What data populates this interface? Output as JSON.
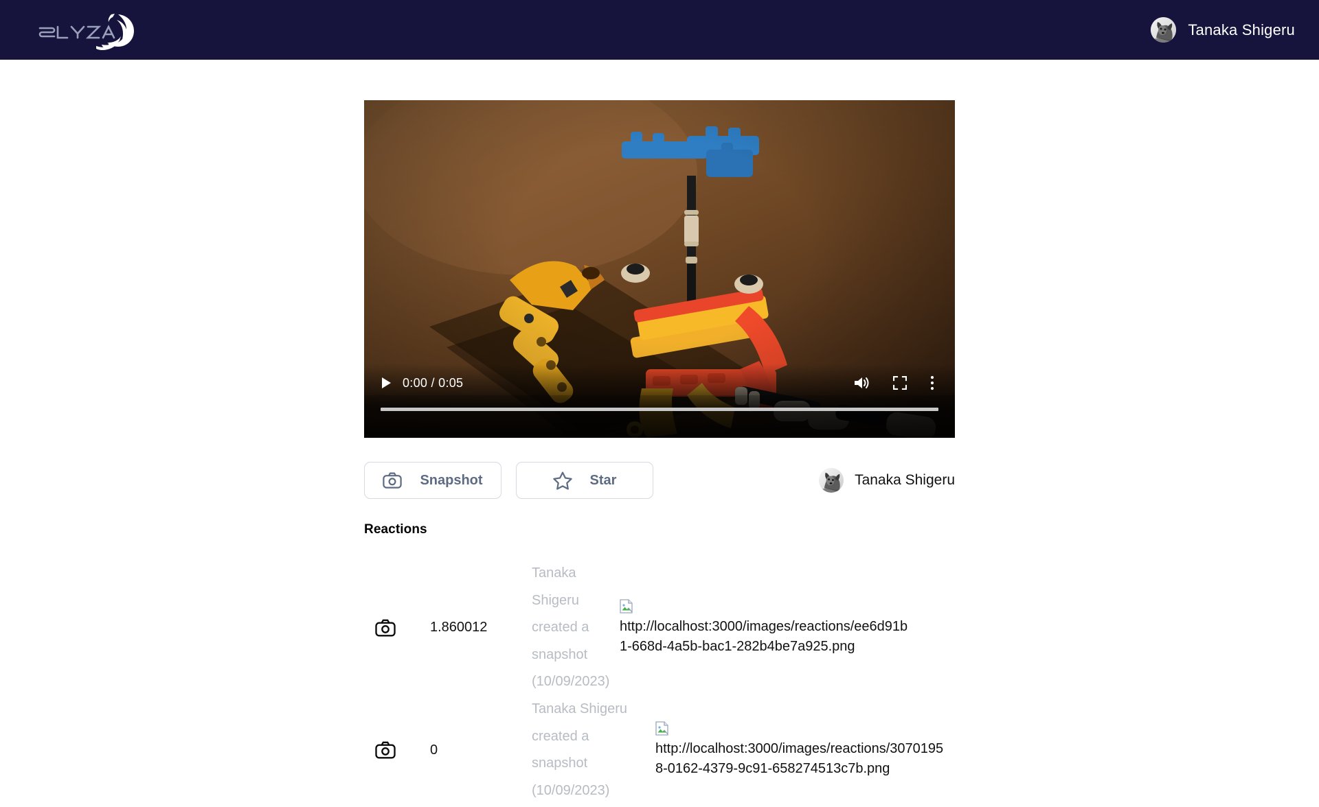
{
  "header": {
    "brand_name": "SPLYZA",
    "brand_icon": "splyza-swirl-logo",
    "user": {
      "name": "Tanaka Shigeru",
      "avatar_icon": "dog-avatar"
    },
    "background_color": "#16143c"
  },
  "video": {
    "current_time": "0:00",
    "duration": "0:05",
    "time_display": "0:00 / 0:05",
    "progress_percent": 0,
    "controls": {
      "play_icon": "play-icon",
      "volume_icon": "volume-on-icon",
      "fullscreen_icon": "fullscreen-icon",
      "more_icon": "more-vertical-icon"
    },
    "poster_description": "LEGO Technic model on warm brown background"
  },
  "actions": {
    "snapshot_label": "Snapshot",
    "snapshot_icon": "camera-icon",
    "star_label": "Star",
    "star_icon": "star-outline-icon",
    "owner": {
      "name": "Tanaka Shigeru",
      "avatar_icon": "dog-avatar"
    },
    "text_color": "#5d6b82",
    "border_color": "#d5d9e0"
  },
  "reactions": {
    "title": "Reactions",
    "items": [
      {
        "icon": "camera-icon",
        "timestamp": "1.860012",
        "description": "Tanaka Shigeru created a snapshot (10/09/2023)",
        "image_alt": "http://localhost:3000/images/reactions/ee6d91b1-668d-4a5b-bac1-282b4be7a925.png",
        "image_state": "broken-image-icon"
      },
      {
        "icon": "camera-icon",
        "timestamp": "0",
        "description": "Tanaka Shigeru created a snapshot (10/09/2023)",
        "image_alt": "http://localhost:3000/images/reactions/30701958-0162-4379-9c91-658274513c7b.png",
        "image_state": "broken-image-icon"
      }
    ],
    "description_color": "#b7bcc4"
  }
}
